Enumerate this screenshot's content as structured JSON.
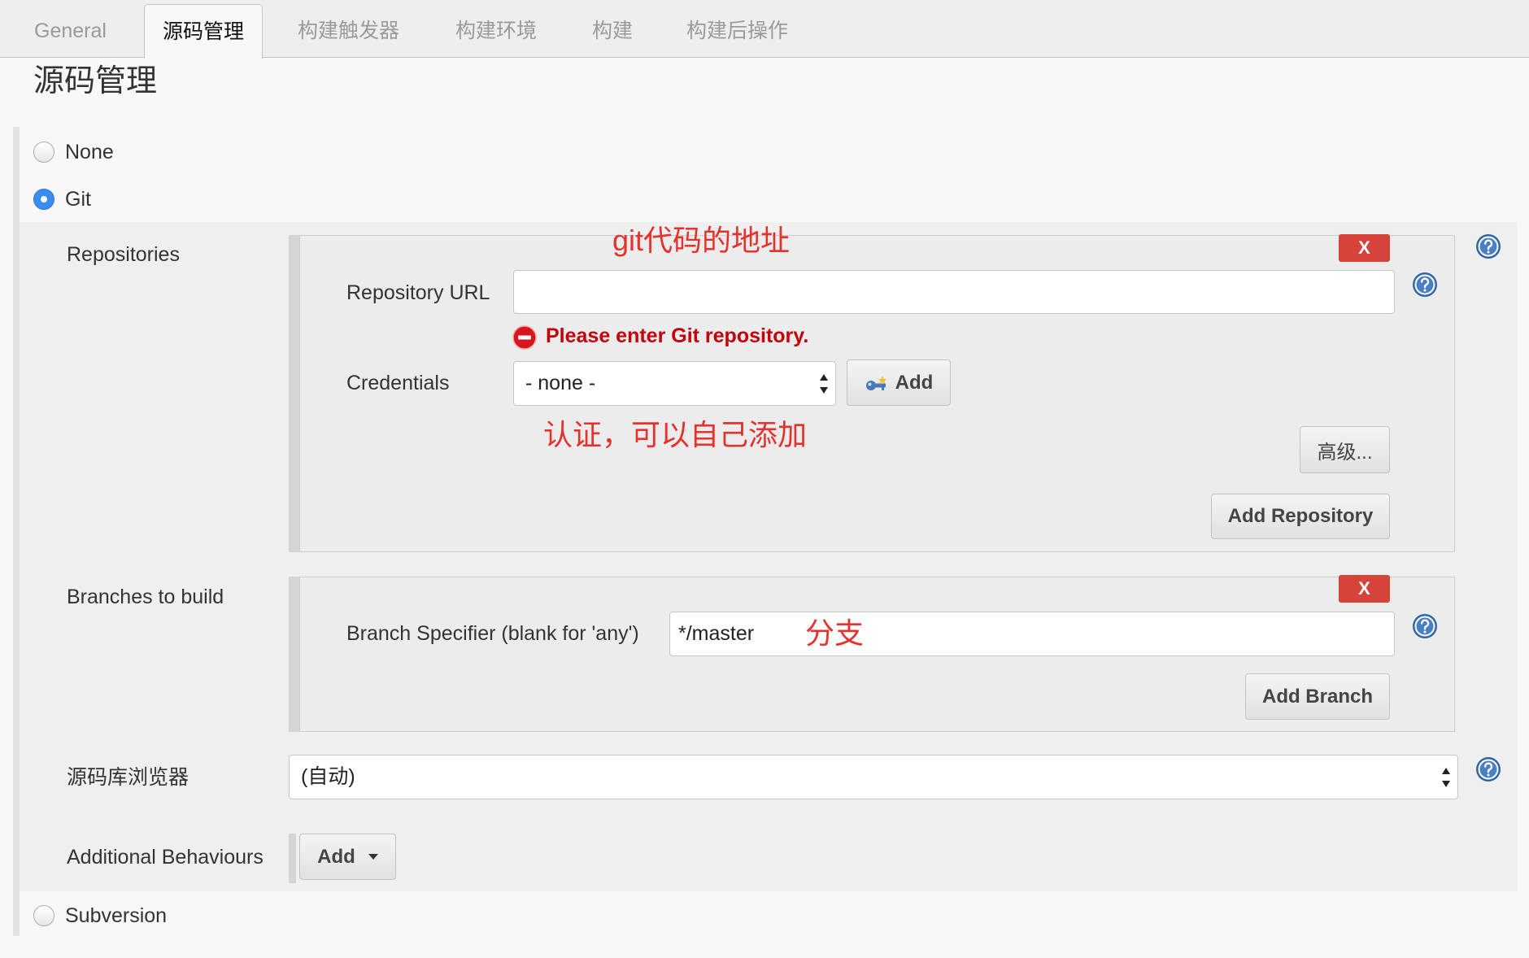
{
  "tabs": [
    {
      "label": "General"
    },
    {
      "label": "源码管理",
      "active": true
    },
    {
      "label": "构建触发器"
    },
    {
      "label": "构建环境"
    },
    {
      "label": "构建"
    },
    {
      "label": "构建后操作"
    }
  ],
  "section_title": "源码管理",
  "scm_options": {
    "none": "None",
    "git": "Git",
    "subversion": "Subversion",
    "selected": "git"
  },
  "git": {
    "repositories_label": "Repositories",
    "repository": {
      "delete_label": "X",
      "url_label": "Repository URL",
      "url_value": "",
      "error": "Please enter Git repository.",
      "credentials_label": "Credentials",
      "credentials_value": "- none -",
      "credentials_add_label": "Add",
      "advanced_label": "高级..."
    },
    "add_repository_label": "Add Repository",
    "branches_label": "Branches to build",
    "branch": {
      "delete_label": "X",
      "specifier_label": "Branch Specifier (blank for 'any')",
      "specifier_value": "*/master"
    },
    "add_branch_label": "Add Branch",
    "browser_label": "源码库浏览器",
    "browser_value": "(自动)",
    "additional_label": "Additional Behaviours",
    "additional_add_label": "Add"
  },
  "annotations": {
    "repo_url": "git代码的地址",
    "credentials": "认证，可以自己添加",
    "branch": "分支"
  },
  "icons": {
    "help": "help-icon",
    "error": "error-icon",
    "credentials": "key-icon"
  },
  "colors": {
    "annotation": "#e5322d",
    "error": "#c4000a",
    "radio_selected": "#3a8cf0",
    "delete_button": "#d6433a",
    "help_icon": "#2f64a8"
  }
}
